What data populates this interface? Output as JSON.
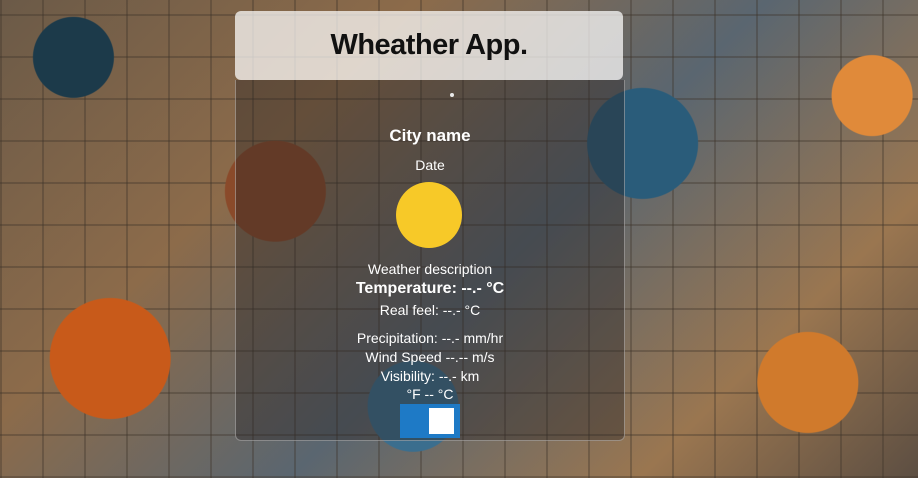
{
  "app": {
    "title": "Wheather App."
  },
  "weather": {
    "city": "City name",
    "date": "Date",
    "description": "Weather description",
    "temperature": "Temperature: --.- °C",
    "real_feel": "Real feel: --.- °C",
    "precipitation": "Precipitation: --.- mm/hr",
    "wind_speed": "Wind Speed --.-- m/s",
    "visibility": "Visibility: --.- km"
  },
  "units_toggle": {
    "label": "°F -- °C",
    "state": "°C"
  },
  "colors": {
    "sun": "#f7c928",
    "toggle": "#1e7ac6",
    "header_bg": "rgba(255,255,255,0.72)"
  },
  "icons": {
    "weather_icon": "sun-icon"
  }
}
